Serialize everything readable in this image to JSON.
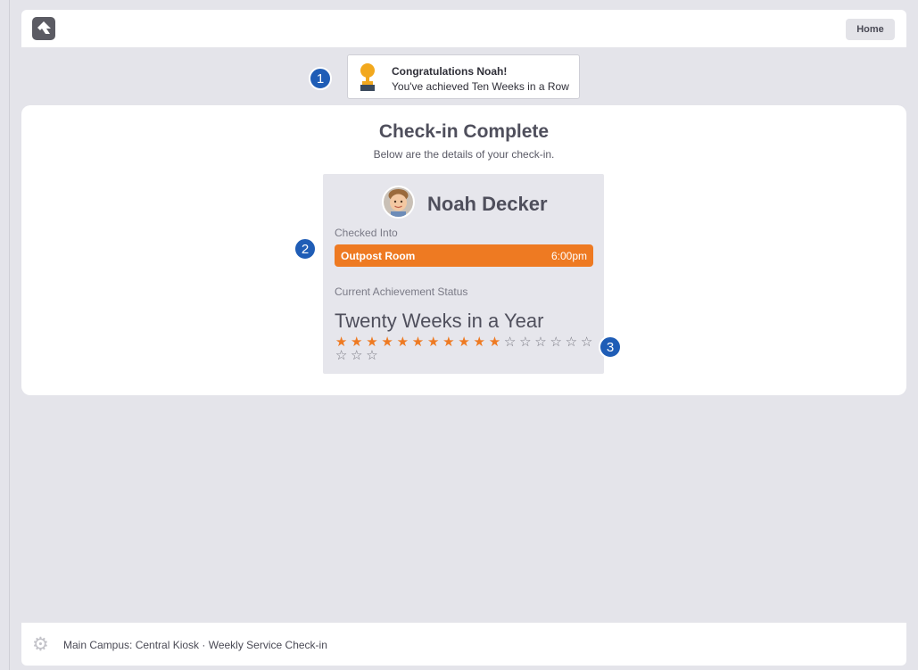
{
  "header": {
    "home_label": "Home",
    "logo_icon": "rock-logo-icon"
  },
  "callouts": [
    "1",
    "2",
    "3"
  ],
  "toast": {
    "icon": "trophy-icon",
    "title": "Congratulations Noah!",
    "message": "You've achieved Ten Weeks in a Row"
  },
  "main": {
    "title": "Check-in Complete",
    "subtitle": "Below are the details of your check-in.",
    "person": {
      "name": "Noah Decker",
      "avatar_icon": "child-avatar",
      "checked_into_label": "Checked Into",
      "location": {
        "name": "Outpost Room",
        "time": "6:00pm"
      },
      "achievement_label": "Current Achievement Status",
      "achievement_name": "Twenty Weeks in a Year",
      "achievement_progress": {
        "earned": 11,
        "total": 20
      }
    }
  },
  "footer": {
    "settings_icon": "gear-icon",
    "text": "Main Campus: Central Kiosk · Weekly Service Check-in"
  },
  "colors": {
    "accent": "#ee7a22",
    "badge": "#1f5db6",
    "background": "#e4e4ea",
    "panel": "#e6e6ec"
  }
}
